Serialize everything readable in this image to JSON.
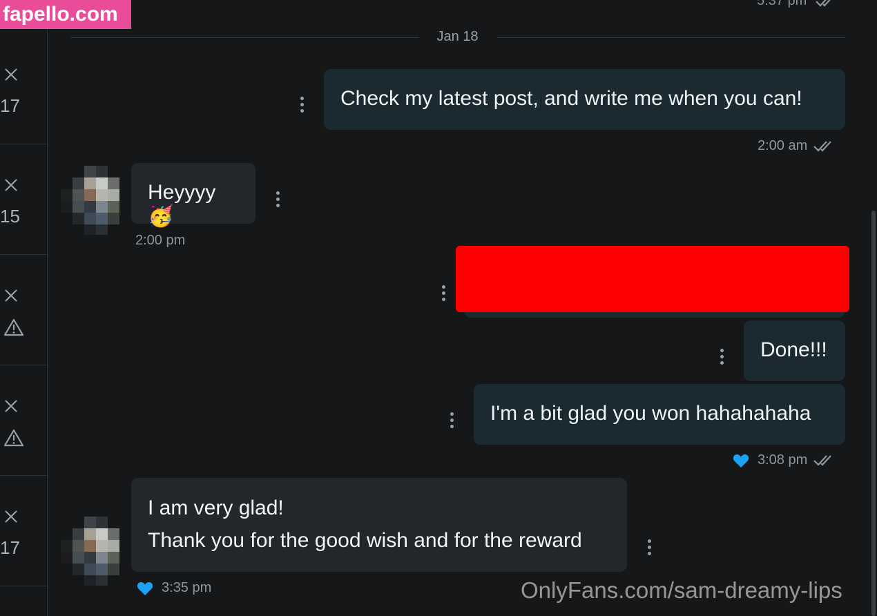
{
  "watermark": {
    "site": "fapello.com",
    "brand": "OnlyFans.com/sam-dreamy-lips"
  },
  "sidebar": {
    "items": [
      {
        "value": "17"
      },
      {
        "value": "15"
      },
      {
        "value": ""
      },
      {
        "value": ""
      },
      {
        "value": "17"
      }
    ]
  },
  "chat": {
    "top_time": "5:37 pm",
    "date_label": "Jan 18",
    "messages": [
      {
        "direction": "out",
        "text": "Check my latest post, and write me when you can!",
        "time": "2:00 am",
        "read": true
      },
      {
        "direction": "in",
        "text": "Heyyyy🥳",
        "time": "2:00 pm"
      },
      {
        "direction": "out",
        "redacted": true
      },
      {
        "direction": "out",
        "text": "Done!!!"
      },
      {
        "direction": "out",
        "text": "I'm a bit glad you won hahahahaha",
        "time": "3:08 pm",
        "liked": true,
        "read": true
      },
      {
        "direction": "in",
        "lines": [
          "I am very glad!",
          "Thank you for the good wish and for the reward"
        ],
        "time": "3:35 pm",
        "liked": true
      }
    ]
  },
  "colors": {
    "like_heart": "#1da1f2",
    "outgoing_bubble": "#1b2a30",
    "incoming_bubble": "#23262b",
    "redaction": "#ff0000",
    "watermark_bg": "#e94d9a"
  }
}
